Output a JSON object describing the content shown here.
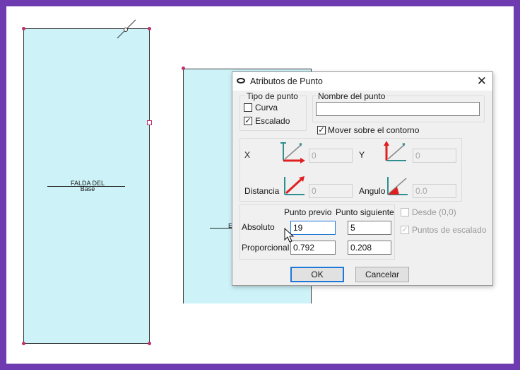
{
  "canvas": {
    "piece_left_label_line1": "FALDA DEL",
    "piece_left_label_line2": "Base",
    "piece_right_label": "E"
  },
  "dialog": {
    "title": "Atributos de Punto",
    "close_glyph": "✕",
    "tipo_de_punto": {
      "label": "Tipo de punto",
      "curva": {
        "label": "Curva",
        "checked": false
      },
      "escalado": {
        "label": "Escalado",
        "checked": true
      }
    },
    "nombre_del_punto": {
      "label": "Nombre del punto",
      "value": ""
    },
    "mover_sobre_contorno": {
      "label": "Mover sobre el contorno",
      "checked": true
    },
    "x": {
      "label": "X",
      "value": "0"
    },
    "y": {
      "label": "Y",
      "value": "0"
    },
    "distancia": {
      "label": "Distancia",
      "value": "0"
    },
    "angulo": {
      "label": "Angulo",
      "value": "0.0"
    },
    "columns": {
      "previo": "Punto previo",
      "siguiente": "Punto siguiente"
    },
    "absoluto": {
      "label": "Absoluto",
      "previo": "19",
      "siguiente": "5"
    },
    "proporcional": {
      "label": "Proporcional",
      "previo": "0.792",
      "siguiente": "0.208"
    },
    "desde": {
      "label": "Desde (0,0)",
      "checked": false
    },
    "puntos_escalado": {
      "label": "Puntos de escalado",
      "checked": true
    },
    "ok": "OK",
    "cancelar": "Cancelar",
    "check_glyph": "✓",
    "colors": {
      "accent": "#1e78d7",
      "arrow_red": "#e02020",
      "arrow_teal": "#2f8f8f"
    }
  }
}
